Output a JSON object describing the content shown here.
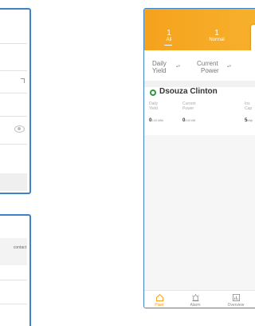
{
  "left_panel": {
    "contact_text": "contact"
  },
  "header": {
    "stats": [
      {
        "count": "1",
        "label": "All"
      },
      {
        "count": "1",
        "label": "Normal"
      }
    ]
  },
  "sort_bar": {
    "items": [
      {
        "label_line1": "Daily",
        "label_line2": "Yield"
      },
      {
        "label_line1": "Current",
        "label_line2": "Power"
      }
    ]
  },
  "plant": {
    "name": "Dsouza Clinton",
    "status_color": "#2e9a3e",
    "metrics": [
      {
        "label_line1": "Daily",
        "label_line2": "Yield",
        "value": "0",
        "unit": "0.00 kWh"
      },
      {
        "label_line1": "Current",
        "label_line2": "Power",
        "value": "0",
        "unit": "0.00 kW"
      },
      {
        "label_line1": "Ins",
        "label_line2": "Cap",
        "value": "5",
        "unit": "kWp"
      }
    ]
  },
  "tabs": [
    {
      "label": "Plant",
      "icon": "home-icon",
      "active": true
    },
    {
      "label": "Alarm",
      "icon": "alarm-icon",
      "active": false
    },
    {
      "label": "Overview",
      "icon": "chart-icon",
      "active": false
    }
  ],
  "colors": {
    "accent": "#f59a12",
    "header": "#f5a21d",
    "frame": "#3e82c8"
  }
}
